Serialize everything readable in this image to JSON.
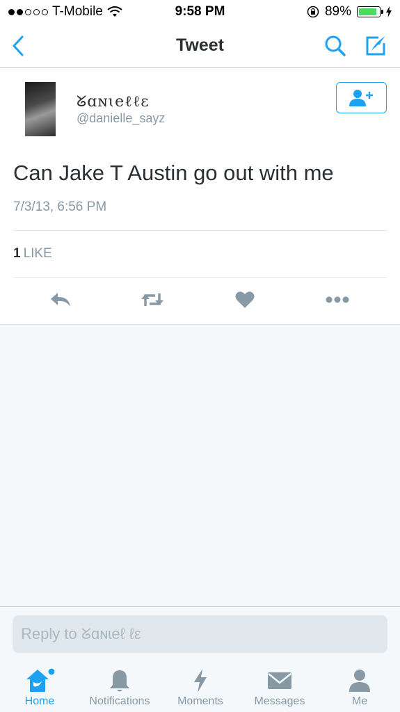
{
  "status_bar": {
    "carrier": "T-Mobile",
    "signal_bars_filled": 2,
    "signal_bars_total": 5,
    "time": "9:58 PM",
    "battery_percent": "89%",
    "battery_level": 0.89
  },
  "nav": {
    "title": "Tweet",
    "back_icon": "chevron-left-icon",
    "search_icon": "search-icon",
    "compose_icon": "compose-icon"
  },
  "tweet": {
    "display_name": "ᘜɑɴɩеℓℓε",
    "handle": "@danielle_sayz",
    "text": "Can Jake T Austin go out with me",
    "timestamp": "7/3/13, 6:56 PM",
    "like_count": "1",
    "like_label": "LIKE",
    "actions": [
      "reply-icon",
      "retweet-icon",
      "heart-icon",
      "more-icon"
    ]
  },
  "reply": {
    "placeholder": "Reply to ᘜɑɴɩеℓ ℓε"
  },
  "tabs": [
    {
      "label": "Home",
      "icon": "home-icon",
      "active": true
    },
    {
      "label": "Notifications",
      "icon": "bell-icon",
      "active": false
    },
    {
      "label": "Moments",
      "icon": "lightning-icon",
      "active": false
    },
    {
      "label": "Messages",
      "icon": "envelope-icon",
      "active": false
    },
    {
      "label": "Me",
      "icon": "person-icon",
      "active": false
    }
  ],
  "colors": {
    "accent": "#1da1f2",
    "icon_gray": "#8899a6",
    "background": "#f5f8fa"
  }
}
